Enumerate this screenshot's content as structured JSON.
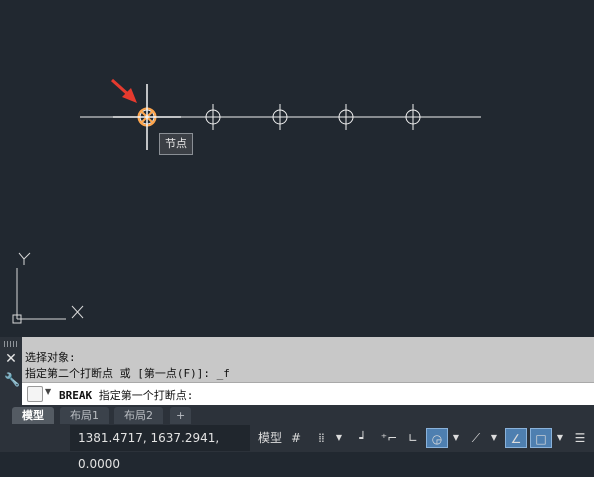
{
  "canvas": {
    "tooltip": "节点",
    "ucs_x": "X",
    "ucs_y": "Y"
  },
  "command": {
    "history_1": "选择对象:",
    "history_2": "指定第二个打断点 或 [第一点(F)]: _f",
    "input_command": "BREAK",
    "input_prompt": " 指定第一个打断点:"
  },
  "tabs": {
    "model": "模型",
    "layout1": "布局1",
    "layout2": "布局2",
    "add": "+"
  },
  "status": {
    "coordinates": "1381.4717, 1637.2941, 0.0000",
    "model_button": "模型"
  },
  "colors": {
    "background": "#212830",
    "selected_node": "#ffa64d",
    "arrow": "#e53a2e",
    "active_toggle": "#4e7fb0"
  }
}
